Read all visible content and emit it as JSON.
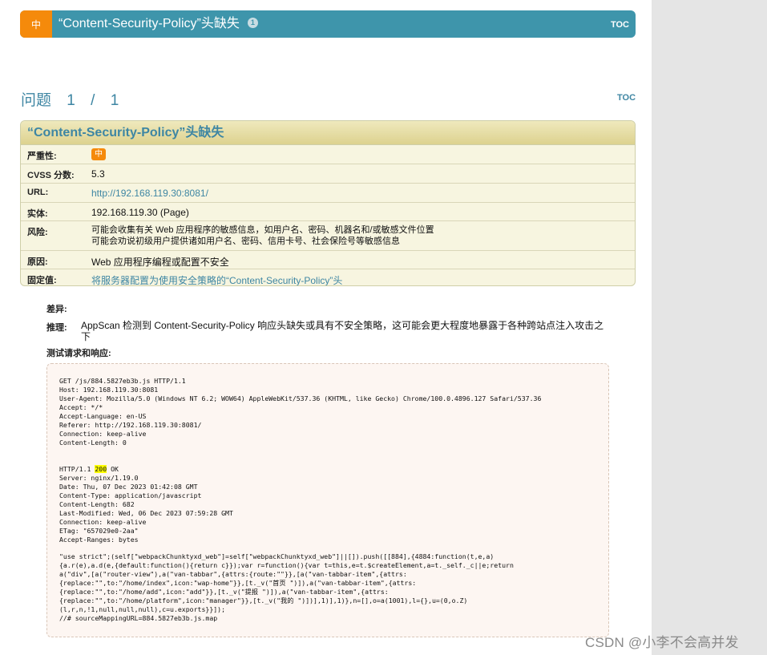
{
  "header": {
    "severity_label": "中",
    "title": "“Content-Security-Policy”头缺失",
    "count": "1",
    "toc": "TOC"
  },
  "issue_heading": {
    "label": "问题",
    "current": "1",
    "sep": "/",
    "total": "1",
    "toc": "TOC"
  },
  "detail": {
    "title": "“Content-Security-Policy”头缺失",
    "rows": [
      {
        "label": "严重性:",
        "value": "中"
      },
      {
        "label": "CVSS 分数:",
        "value": "5.3"
      },
      {
        "label": "URL:",
        "value": "http://192.168.119.30:8081/"
      },
      {
        "label": "实体:",
        "value": "192.168.119.30 (Page)"
      },
      {
        "label": "风险:",
        "value_line1": "可能会收集有关 Web 应用程序的敏感信息，如用户名、密码、机器名和/或敏感文件位置",
        "value_line2": "可能会劝说初级用户提供诸如用户名、密码、信用卡号、社会保险号等敏感信息"
      },
      {
        "label": "原因:",
        "value": "Web 应用程序编程或配置不安全"
      },
      {
        "label": "固定值:",
        "value": "将服务器配置为使用安全策略的“Content-Security-Policy”头"
      }
    ]
  },
  "diff_label": "差异:",
  "reason": {
    "label": "推理:",
    "text": "AppScan 检测到 Content-Security-Policy 响应头缺失或具有不安全策略，这可能会更大程度地暴露于各种跨站点注入攻击之下"
  },
  "test_label": "测试请求和响应:",
  "request": "GET /js/884.5827eb3b.js HTTP/1.1\nHost: 192.168.119.30:8081\nUser-Agent: Mozilla/5.0 (Windows NT 6.2; WOW64) AppleWebKit/537.36 (KHTML, like Gecko) Chrome/100.0.4896.127 Safari/537.36\nAccept: */*\nAccept-Language: en-US\nReferer: http://192.168.119.30:8081/\nConnection: keep-alive\nContent-Length: 0",
  "response_status_prefix": "HTTP/1.1 ",
  "response_status_code": "200",
  "response_status_suffix": " OK",
  "response_headers": "Server: nginx/1.19.0\nDate: Thu, 07 Dec 2023 01:42:08 GMT\nContent-Type: application/javascript\nContent-Length: 682\nLast-Modified: Wed, 06 Dec 2023 07:59:28 GMT\nConnection: keep-alive\nETag: \"657029e0-2aa\"\nAccept-Ranges: bytes",
  "response_body": "\"use strict\";(self[\"webpackChunktyxd_web\"]=self[\"webpackChunktyxd_web\"]||[]).push([[884],{4884:function(t,e,a)\n{a.r(e),a.d(e,{default:function(){return c}});var r=function(){var t=this,e=t.$createElement,a=t._self._c||e;return\na(\"div\",[a(\"router-view\"),a(\"van-tabbar\",{attrs:{route:\"\"}},[a(\"van-tabbar-item\",{attrs:\n{replace:\"\",to:\"/home/index\",icon:\"wap-home\"}},[t._v(\"首页 \")]),a(\"van-tabbar-item\",{attrs:\n{replace:\"\",to:\"/home/add\",icon:\"add\"}},[t._v(\"提报 \")]),a(\"van-tabbar-item\",{attrs:\n{replace:\"\",to:\"/home/platform\",icon:\"manager\"}},[t._v(\"我的 \")])],1)],1)},n=[],o=a(1001),l={},u=(0,o.Z)\n(l,r,n,!1,null,null,null),c=u.exports}}]);\n//# sourceMappingURL=884.5827eb3b.js.map",
  "watermark": "CSDN @小李不会高并发"
}
